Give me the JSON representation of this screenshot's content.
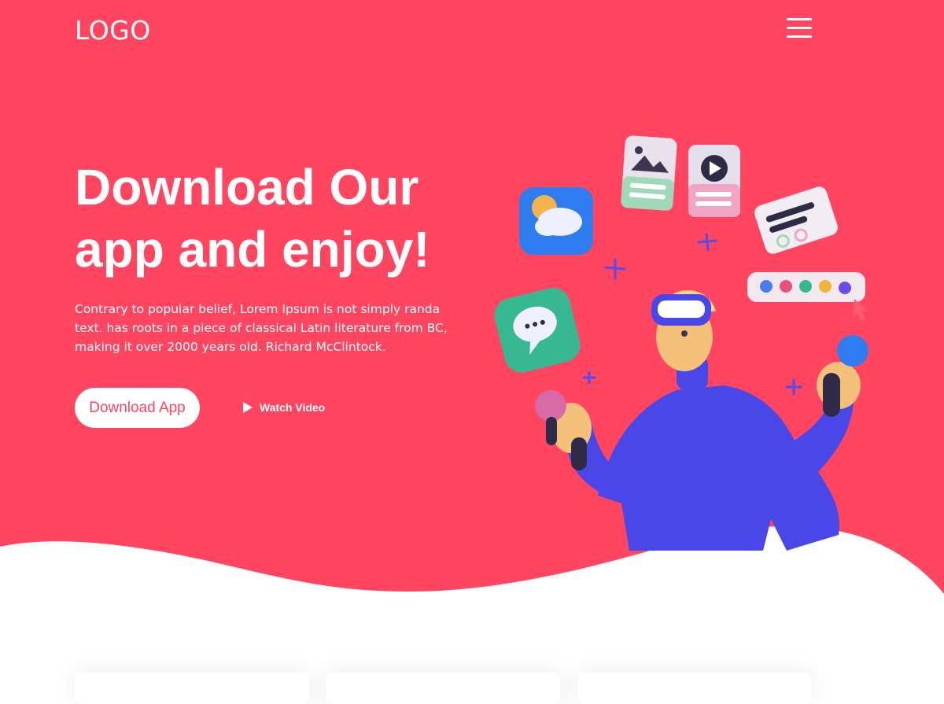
{
  "header": {
    "logo": "LOGO",
    "menu_icon": "hamburger-menu-icon"
  },
  "hero": {
    "title_line1": "Download Our",
    "title_line2": "app and enjoy!",
    "description": "Contrary to popular belief, Lorem Ipsum is not simply randa text. has roots in a piece of classical Latin literature from BC, making it over 2000 years old. Richard McClintock.",
    "download_button": "Download App",
    "watch_video": "Watch Video",
    "watch_video_icon": "play-icon"
  },
  "colors": {
    "hero_background": "#ff4560",
    "text_light": "#ffffff",
    "accent": "#ff4560",
    "figure_blue": "#4a47e8"
  },
  "illustration": {
    "icons": [
      "weather-icon",
      "image-card-icon",
      "video-card-icon",
      "text-card-icon",
      "color-palette-icon",
      "chat-bubble-icon"
    ]
  }
}
